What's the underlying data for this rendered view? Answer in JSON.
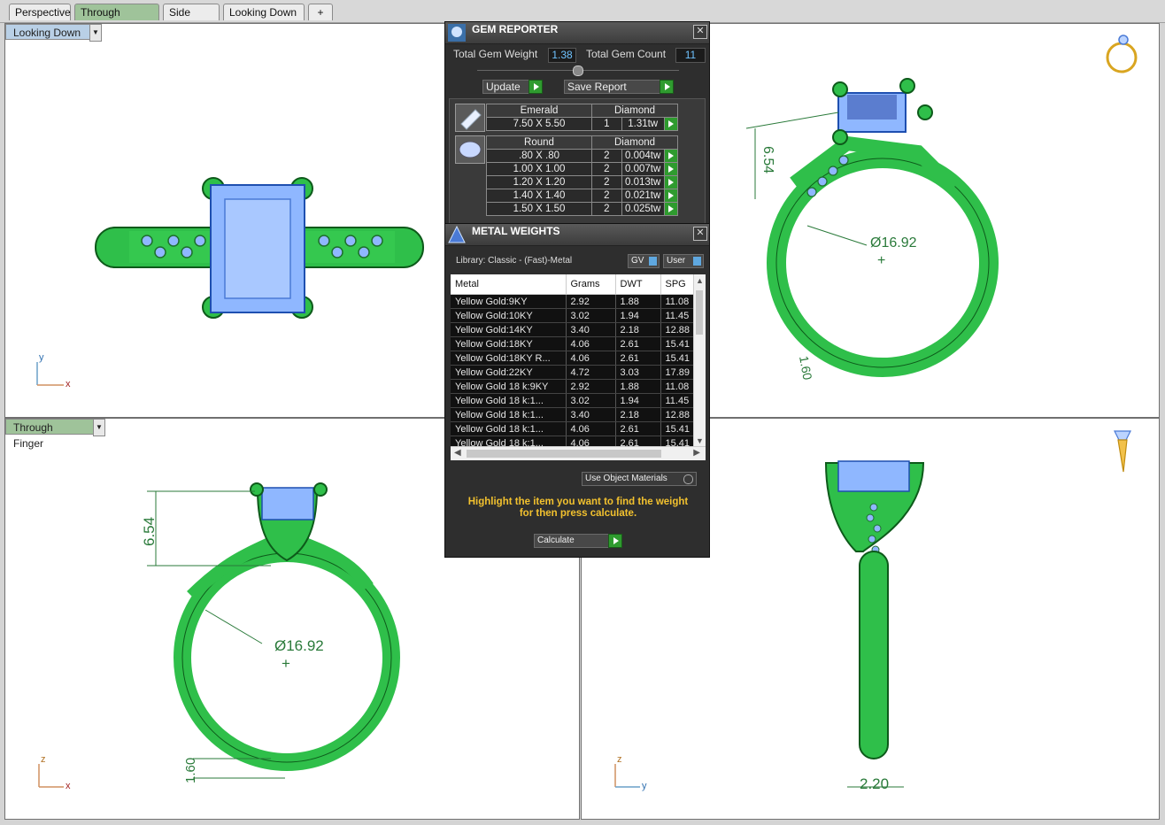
{
  "tabs": [
    "Perspective",
    "Through Finger",
    "Side View",
    "Looking Down",
    "+"
  ],
  "viewports": {
    "top_left_label": "Looking Down",
    "bottom_left_label": "Through Finger"
  },
  "dimensions": {
    "height": "6.54",
    "diameter": "Ø16.92",
    "shank": "1.60",
    "width": "2.20"
  },
  "axes": {
    "x": "x",
    "y": "y",
    "z": "z"
  },
  "gem_reporter": {
    "title": "GEM REPORTER",
    "total_weight_label": "Total Gem Weight",
    "total_weight": "1.38",
    "total_count_label": "Total Gem Count",
    "total_count": "11",
    "update": "Update",
    "save_report": "Save Report",
    "group1": {
      "shape": "Emerald",
      "type": "Diamond",
      "rows": [
        [
          "7.50 X 5.50",
          "1",
          "1.31tw"
        ]
      ]
    },
    "group2": {
      "shape": "Round",
      "type": "Diamond",
      "rows": [
        [
          ".80 X .80",
          "2",
          "0.004tw"
        ],
        [
          "1.00 X 1.00",
          "2",
          "0.007tw"
        ],
        [
          "1.20 X 1.20",
          "2",
          "0.013tw"
        ],
        [
          "1.40 X 1.40",
          "2",
          "0.021tw"
        ],
        [
          "1.50 X 1.50",
          "2",
          "0.025tw"
        ]
      ]
    }
  },
  "metal_weights": {
    "title": "METAL WEIGHTS",
    "library": "Library: Classic - (Fast)-Metal",
    "gv": "GV",
    "user": "User",
    "columns": [
      "Metal",
      "Grams",
      "DWT",
      "SPG"
    ],
    "rows": [
      [
        "Yellow Gold:9KY",
        "2.92",
        "1.88",
        "11.08"
      ],
      [
        "Yellow Gold:10KY",
        "3.02",
        "1.94",
        "11.45"
      ],
      [
        "Yellow Gold:14KY",
        "3.40",
        "2.18",
        "12.88"
      ],
      [
        "Yellow Gold:18KY",
        "4.06",
        "2.61",
        "15.41"
      ],
      [
        "Yellow Gold:18KY R...",
        "4.06",
        "2.61",
        "15.41"
      ],
      [
        "Yellow Gold:22KY",
        "4.72",
        "3.03",
        "17.89"
      ],
      [
        "Yellow Gold 18 k:9KY",
        "2.92",
        "1.88",
        "11.08"
      ],
      [
        "Yellow Gold 18 k:1...",
        "3.02",
        "1.94",
        "11.45"
      ],
      [
        "Yellow Gold 18 k:1...",
        "3.40",
        "2.18",
        "12.88"
      ],
      [
        "Yellow Gold 18 k:1...",
        "4.06",
        "2.61",
        "15.41"
      ],
      [
        "Yellow Gold 18 k:1...",
        "4.06",
        "2.61",
        "15.41"
      ]
    ],
    "use_object_materials": "Use Object Materials",
    "hint": "Highlight the item you want to find the weight for then press calculate.",
    "calculate": "Calculate"
  }
}
